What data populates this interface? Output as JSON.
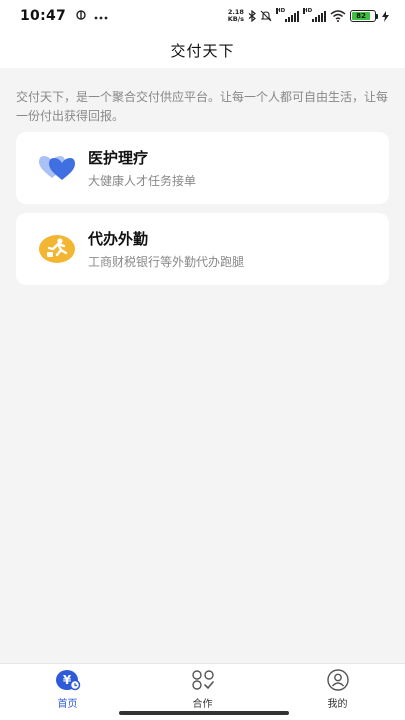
{
  "status_bar": {
    "time": "10:47",
    "left_icons": [
      "wechat-pay-icon",
      "more-dots-icon"
    ],
    "speed_value": "2.18",
    "speed_unit": "KB/s",
    "hd_label": "HD",
    "battery_level": "82",
    "battery_color": "#3fbf3f"
  },
  "header": {
    "title": "交付天下"
  },
  "intro": {
    "text": "交付天下，是一个聚合交付供应平台。让每一个人都可自由生活，让每一份付出获得回报。"
  },
  "cards": [
    {
      "title": "医护理疗",
      "subtitle": "大健康人才任务接单",
      "icon": "heart-icon",
      "icon_color": "#3f6fe0"
    },
    {
      "title": "代办外勤",
      "subtitle": "工商财税银行等外勤代办跑腿",
      "icon": "running-person-icon",
      "icon_color": "#f2b633"
    }
  ],
  "tabbar": {
    "accent": "#2e5bd8",
    "tabs": [
      {
        "label": "首页",
        "icon": "yuan-home-icon",
        "active": true
      },
      {
        "label": "合作",
        "icon": "cooperation-grid-icon",
        "active": false
      },
      {
        "label": "我的",
        "icon": "user-profile-icon",
        "active": false
      }
    ]
  }
}
